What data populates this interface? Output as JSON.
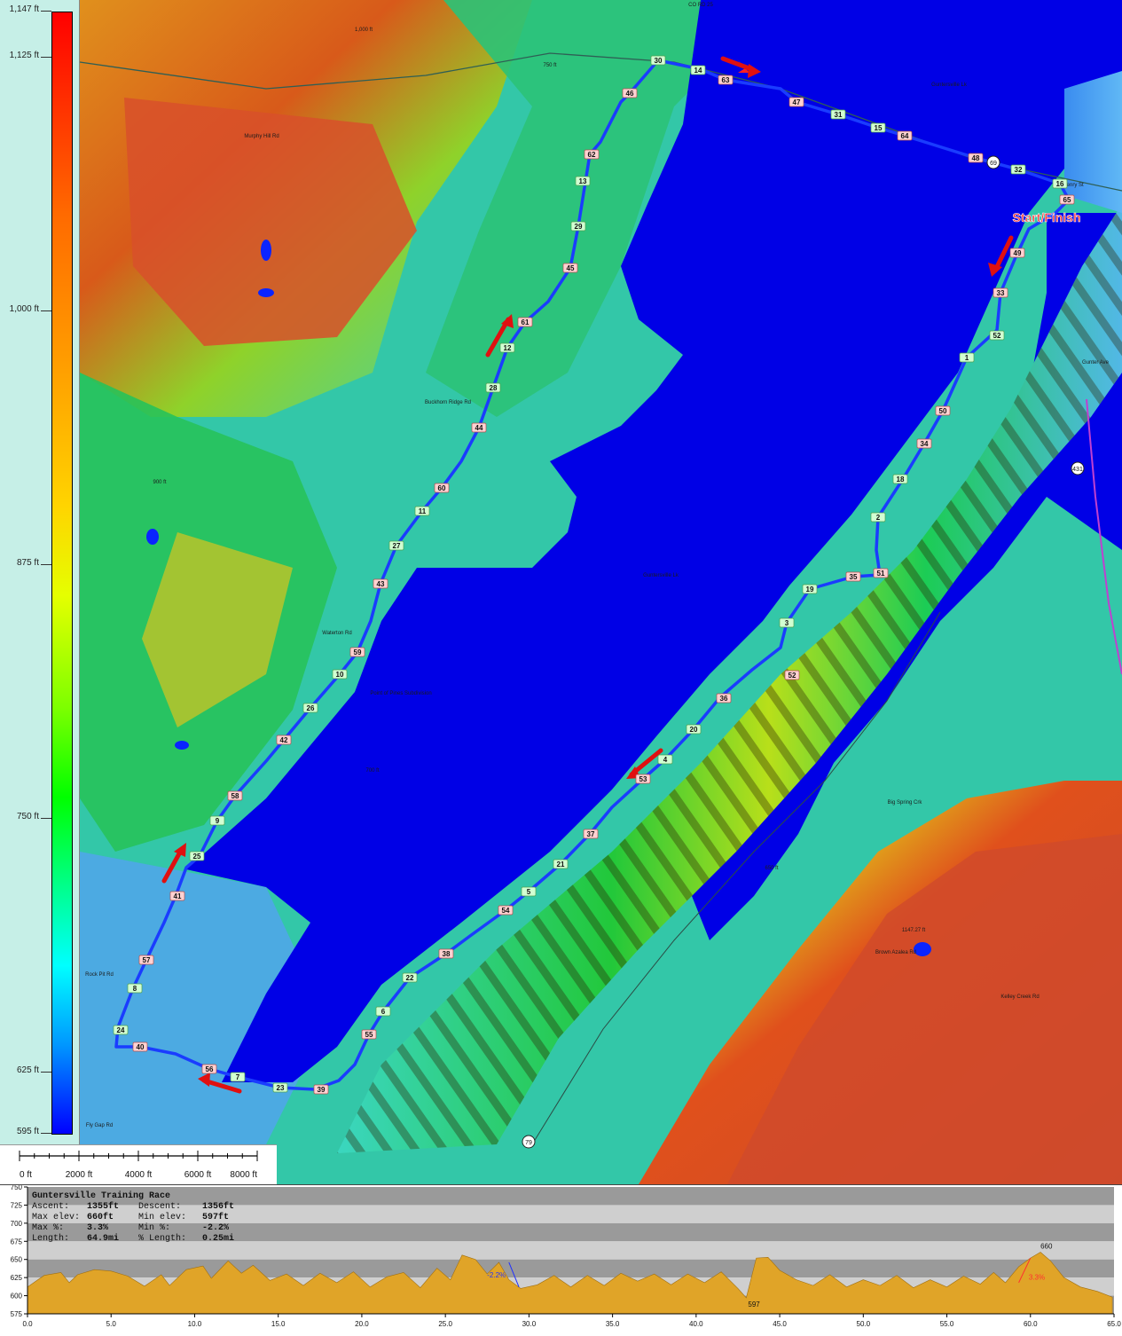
{
  "legend": {
    "labels": [
      "1,147 ft",
      "1,125 ft",
      "1,000 ft",
      "875 ft",
      "750 ft",
      "625 ft",
      "595 ft"
    ],
    "colors": [
      "#ff0000",
      "#ffa000",
      "#ffff00",
      "#00ff00",
      "#00ffff",
      "#0000ff"
    ]
  },
  "scale": {
    "labels": [
      "0 ft",
      "2000 ft",
      "4000 ft",
      "6000 ft",
      "8000 ft"
    ]
  },
  "map": {
    "start_finish": "Start/Finish",
    "water_color": "#0000e6",
    "route_color": "#1a3cff",
    "roads": [
      "CO RD 25",
      "69",
      "431",
      "79",
      "Henry St",
      "Gunter Ave",
      "Guntersville Lk",
      "Guntersville Lk",
      "Big Spring Crk",
      "Brown Azalea Rd",
      "1147.27 ft",
      "1,000 ft",
      "750 ft",
      "900 ft",
      "650 ft",
      "700 ft",
      "Point of Pines Subdivision",
      "Waterton Rd",
      "Rock Pit Rd",
      "Fly Gap Rd",
      "Kelley Creek Rd",
      "Buckhorn Ridge Rd",
      "Murphy Hill Rd"
    ],
    "checkpoints": [
      {
        "n": "30",
        "kind": "odd"
      },
      {
        "n": "14",
        "kind": "odd"
      },
      {
        "n": "63",
        "kind": "even"
      },
      {
        "n": "46",
        "kind": "even"
      },
      {
        "n": "47",
        "kind": "even"
      },
      {
        "n": "31",
        "kind": "odd"
      },
      {
        "n": "15",
        "kind": "odd"
      },
      {
        "n": "64",
        "kind": "even"
      },
      {
        "n": "48",
        "kind": "even"
      },
      {
        "n": "32",
        "kind": "odd"
      },
      {
        "n": "16",
        "kind": "odd"
      },
      {
        "n": "65",
        "kind": "even"
      },
      {
        "n": "49",
        "kind": "even"
      },
      {
        "n": "33",
        "kind": "even"
      },
      {
        "n": "52",
        "kind": "odd"
      },
      {
        "n": "1",
        "kind": "odd"
      },
      {
        "n": "50",
        "kind": "even"
      },
      {
        "n": "34",
        "kind": "even"
      },
      {
        "n": "18",
        "kind": "odd"
      },
      {
        "n": "2",
        "kind": "odd"
      },
      {
        "n": "51",
        "kind": "even"
      },
      {
        "n": "35",
        "kind": "even"
      },
      {
        "n": "19",
        "kind": "odd"
      },
      {
        "n": "3",
        "kind": "odd"
      },
      {
        "n": "52",
        "kind": "even"
      },
      {
        "n": "36",
        "kind": "even"
      },
      {
        "n": "20",
        "kind": "odd"
      },
      {
        "n": "4",
        "kind": "odd"
      },
      {
        "n": "53",
        "kind": "even"
      },
      {
        "n": "37",
        "kind": "even"
      },
      {
        "n": "21",
        "kind": "odd"
      },
      {
        "n": "5",
        "kind": "odd"
      },
      {
        "n": "54",
        "kind": "even"
      },
      {
        "n": "38",
        "kind": "even"
      },
      {
        "n": "22",
        "kind": "odd"
      },
      {
        "n": "6",
        "kind": "odd"
      },
      {
        "n": "55",
        "kind": "even"
      },
      {
        "n": "39",
        "kind": "even"
      },
      {
        "n": "23",
        "kind": "odd"
      },
      {
        "n": "7",
        "kind": "odd"
      },
      {
        "n": "56",
        "kind": "even"
      },
      {
        "n": "40",
        "kind": "even"
      },
      {
        "n": "24",
        "kind": "odd"
      },
      {
        "n": "8",
        "kind": "odd"
      },
      {
        "n": "57",
        "kind": "even"
      },
      {
        "n": "41",
        "kind": "even"
      },
      {
        "n": "25",
        "kind": "odd"
      },
      {
        "n": "9",
        "kind": "odd"
      },
      {
        "n": "58",
        "kind": "even"
      },
      {
        "n": "42",
        "kind": "even"
      },
      {
        "n": "26",
        "kind": "odd"
      },
      {
        "n": "10",
        "kind": "odd"
      },
      {
        "n": "59",
        "kind": "even"
      },
      {
        "n": "43",
        "kind": "even"
      },
      {
        "n": "27",
        "kind": "odd"
      },
      {
        "n": "11",
        "kind": "odd"
      },
      {
        "n": "60",
        "kind": "even"
      },
      {
        "n": "44",
        "kind": "even"
      },
      {
        "n": "28",
        "kind": "odd"
      },
      {
        "n": "12",
        "kind": "odd"
      },
      {
        "n": "61",
        "kind": "even"
      },
      {
        "n": "45",
        "kind": "even"
      },
      {
        "n": "29",
        "kind": "odd"
      },
      {
        "n": "13",
        "kind": "odd"
      },
      {
        "n": "62",
        "kind": "even"
      }
    ]
  },
  "profile": {
    "title": "Guntersville Training Race",
    "ascent_label": "Ascent:",
    "ascent": "1355ft",
    "descent_label": "Descent:",
    "descent": "1356ft",
    "max_elev_label": "Max elev:",
    "max_elev": "660ft",
    "min_elev_label": "Min elev:",
    "min_elev": "597ft",
    "max_pct_label": "Max %:",
    "max_pct": "3.3%",
    "min_pct_label": "Min %:",
    "min_pct": "-2.2%",
    "length_label": "Length:",
    "length": "64.9mi",
    "pct_length_label": "% Length:",
    "pct_length": "0.25mi",
    "peak_label": "660",
    "low_label": "597",
    "min_grade_label": "-2.2%",
    "max_grade_label": "3.3%",
    "y_ticks": [
      "750",
      "725",
      "700",
      "675",
      "650",
      "625",
      "600",
      "575"
    ],
    "x_ticks": [
      "0.0",
      "5.0",
      "10.0",
      "15.0",
      "20.0",
      "25.0",
      "30.0",
      "35.0",
      "40.0",
      "45.0",
      "50.0",
      "55.0",
      "60.0",
      "65.0"
    ],
    "fill_color": "#e0a428",
    "band_colors": [
      "#9a9a9a",
      "#cfcfcf"
    ],
    "elevation": [
      {
        "x": 0.0,
        "y": 612
      },
      {
        "x": 1.0,
        "y": 628
      },
      {
        "x": 2.0,
        "y": 632
      },
      {
        "x": 2.5,
        "y": 618
      },
      {
        "x": 3.0,
        "y": 629
      },
      {
        "x": 4.0,
        "y": 636
      },
      {
        "x": 5.0,
        "y": 634
      },
      {
        "x": 6.0,
        "y": 627
      },
      {
        "x": 7.0,
        "y": 613
      },
      {
        "x": 8.0,
        "y": 629
      },
      {
        "x": 8.5,
        "y": 614
      },
      {
        "x": 9.5,
        "y": 636
      },
      {
        "x": 10.5,
        "y": 641
      },
      {
        "x": 11.0,
        "y": 624
      },
      {
        "x": 12.0,
        "y": 648
      },
      {
        "x": 12.8,
        "y": 631
      },
      {
        "x": 13.5,
        "y": 642
      },
      {
        "x": 14.5,
        "y": 621
      },
      {
        "x": 15.5,
        "y": 630
      },
      {
        "x": 16.5,
        "y": 614
      },
      {
        "x": 17.5,
        "y": 631
      },
      {
        "x": 18.5,
        "y": 618
      },
      {
        "x": 19.5,
        "y": 633
      },
      {
        "x": 20.5,
        "y": 612
      },
      {
        "x": 21.5,
        "y": 626
      },
      {
        "x": 22.5,
        "y": 632
      },
      {
        "x": 23.5,
        "y": 611
      },
      {
        "x": 24.5,
        "y": 638
      },
      {
        "x": 25.3,
        "y": 622
      },
      {
        "x": 26.0,
        "y": 656
      },
      {
        "x": 26.8,
        "y": 650
      },
      {
        "x": 27.5,
        "y": 630
      },
      {
        "x": 28.2,
        "y": 646
      },
      {
        "x": 28.8,
        "y": 622
      },
      {
        "x": 29.5,
        "y": 610
      },
      {
        "x": 30.5,
        "y": 615
      },
      {
        "x": 31.5,
        "y": 628
      },
      {
        "x": 32.5,
        "y": 612
      },
      {
        "x": 33.5,
        "y": 628
      },
      {
        "x": 34.5,
        "y": 614
      },
      {
        "x": 35.5,
        "y": 631
      },
      {
        "x": 36.5,
        "y": 620
      },
      {
        "x": 37.5,
        "y": 630
      },
      {
        "x": 38.5,
        "y": 615
      },
      {
        "x": 39.5,
        "y": 630
      },
      {
        "x": 40.5,
        "y": 618
      },
      {
        "x": 41.5,
        "y": 633
      },
      {
        "x": 42.5,
        "y": 610
      },
      {
        "x": 43.0,
        "y": 597
      },
      {
        "x": 43.6,
        "y": 652
      },
      {
        "x": 44.3,
        "y": 653
      },
      {
        "x": 45.0,
        "y": 635
      },
      {
        "x": 46.0,
        "y": 622
      },
      {
        "x": 47.0,
        "y": 614
      },
      {
        "x": 48.0,
        "y": 629
      },
      {
        "x": 49.0,
        "y": 612
      },
      {
        "x": 50.0,
        "y": 622
      },
      {
        "x": 51.0,
        "y": 614
      },
      {
        "x": 52.0,
        "y": 628
      },
      {
        "x": 53.0,
        "y": 611
      },
      {
        "x": 54.0,
        "y": 622
      },
      {
        "x": 55.0,
        "y": 612
      },
      {
        "x": 56.0,
        "y": 627
      },
      {
        "x": 57.0,
        "y": 616
      },
      {
        "x": 57.8,
        "y": 632
      },
      {
        "x": 58.5,
        "y": 618
      },
      {
        "x": 59.3,
        "y": 640
      },
      {
        "x": 60.0,
        "y": 652
      },
      {
        "x": 60.6,
        "y": 660
      },
      {
        "x": 61.2,
        "y": 648
      },
      {
        "x": 62.0,
        "y": 625
      },
      {
        "x": 63.0,
        "y": 612
      },
      {
        "x": 64.0,
        "y": 606
      },
      {
        "x": 64.9,
        "y": 598
      }
    ]
  }
}
